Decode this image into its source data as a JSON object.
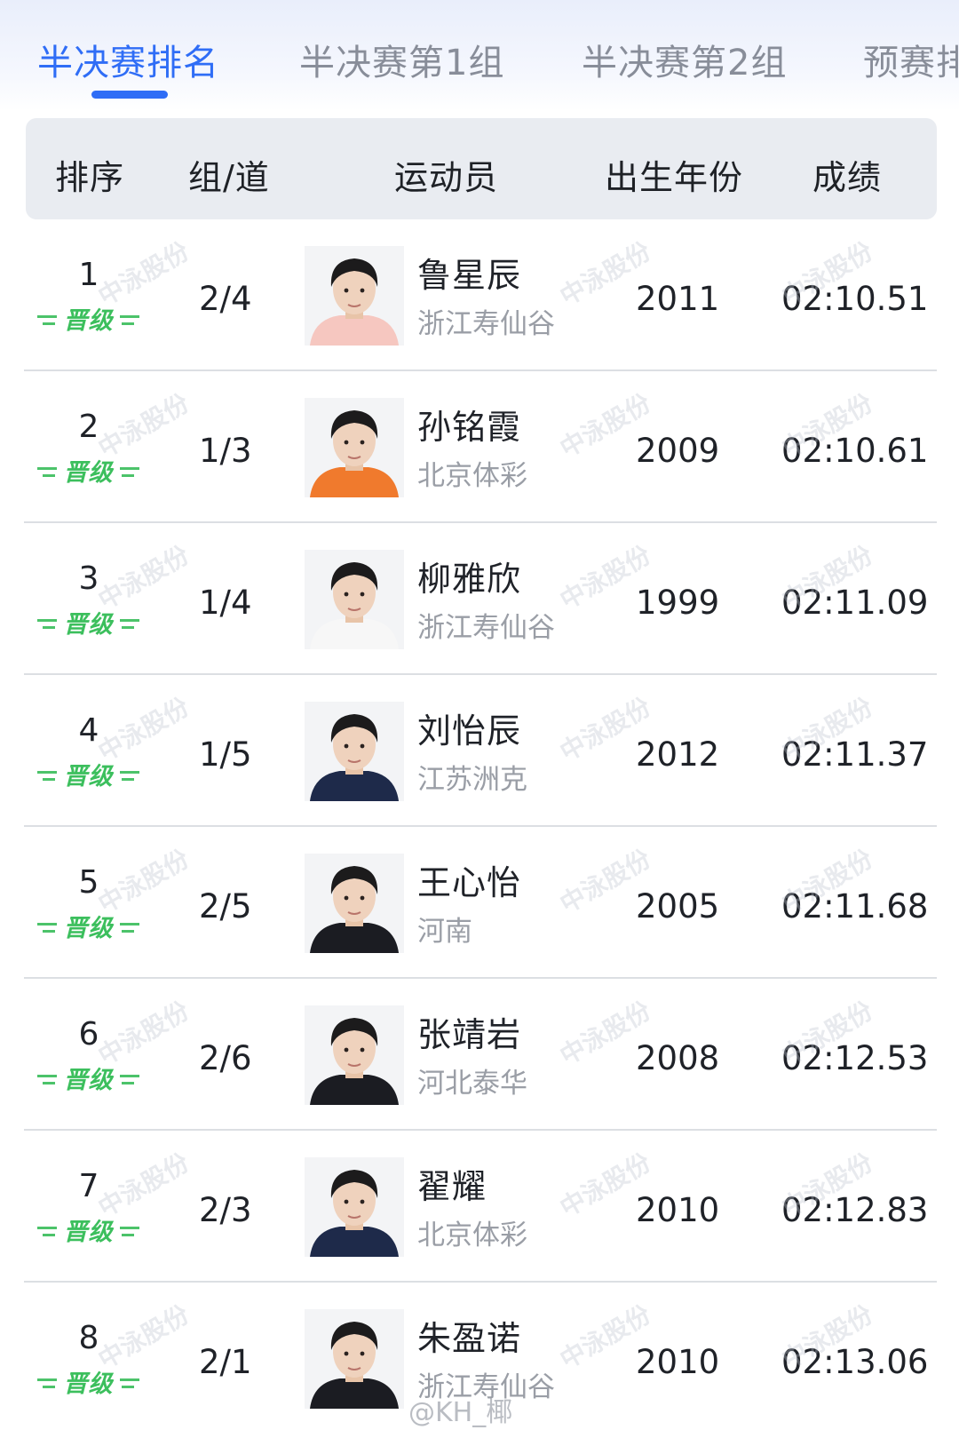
{
  "tabs": [
    {
      "label": "半决赛排名",
      "active": true
    },
    {
      "label": "半决赛第1组",
      "active": false
    },
    {
      "label": "半决赛第2组",
      "active": false
    },
    {
      "label": "预赛排",
      "active": false
    }
  ],
  "header": {
    "rank": "排序",
    "group_lane": "组/道",
    "athlete": "运动员",
    "birth_year": "出生年份",
    "result": "成绩"
  },
  "badge_label": "晋级",
  "watermark_text": "中泳股份",
  "credit": "@KH_椰",
  "rows": [
    {
      "rank": "1",
      "lane": "2/4",
      "name": "鲁星辰",
      "team": "浙江寿仙谷",
      "year": "2011",
      "time": "02:10.51",
      "shirt": "#f6c7c0"
    },
    {
      "rank": "2",
      "lane": "1/3",
      "name": "孙铭霞",
      "team": "北京体彩",
      "year": "2009",
      "time": "02:10.61",
      "shirt": "#f07a2d"
    },
    {
      "rank": "3",
      "lane": "1/4",
      "name": "柳雅欣",
      "team": "浙江寿仙谷",
      "year": "1999",
      "time": "02:11.09",
      "shirt": "#f7f7f7"
    },
    {
      "rank": "4",
      "lane": "1/5",
      "name": "刘怡辰",
      "team": "江苏洲克",
      "year": "2012",
      "time": "02:11.37",
      "shirt": "#1e2a4a"
    },
    {
      "rank": "5",
      "lane": "2/5",
      "name": "王心怡",
      "team": "河南",
      "year": "2005",
      "time": "02:11.68",
      "shirt": "#1b1c22"
    },
    {
      "rank": "6",
      "lane": "2/6",
      "name": "张靖岩",
      "team": "河北泰华",
      "year": "2008",
      "time": "02:12.53",
      "shirt": "#1b1c22"
    },
    {
      "rank": "7",
      "lane": "2/3",
      "name": "翟耀",
      "team": "北京体彩",
      "year": "2010",
      "time": "02:12.83",
      "shirt": "#1e2a4a"
    },
    {
      "rank": "8",
      "lane": "2/1",
      "name": "朱盈诺",
      "team": "浙江寿仙谷",
      "year": "2010",
      "time": "02:13.06",
      "shirt": "#1b1c22"
    }
  ]
}
